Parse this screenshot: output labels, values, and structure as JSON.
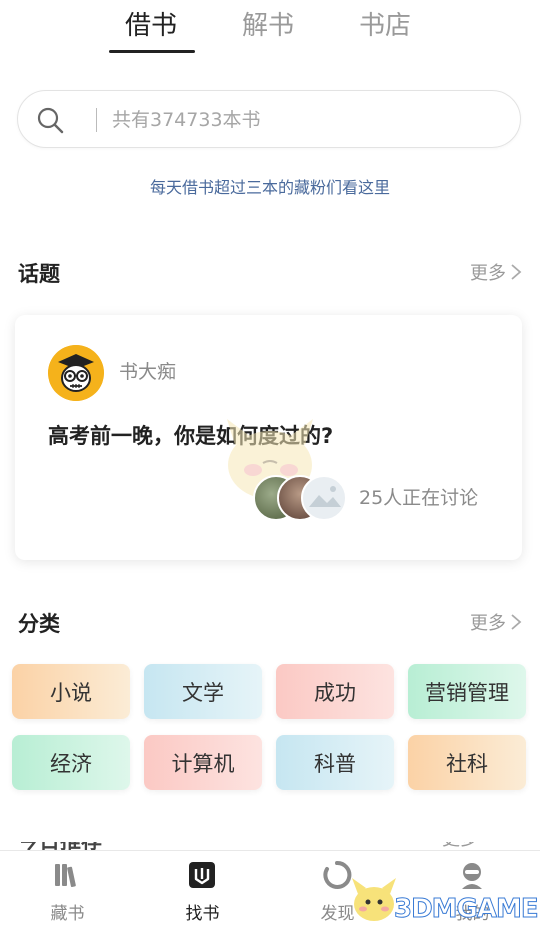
{
  "tabs": [
    {
      "label": "借书",
      "active": true
    },
    {
      "label": "解书",
      "active": false
    },
    {
      "label": "书店",
      "active": false
    }
  ],
  "search": {
    "placeholder": "共有374733本书",
    "icon": "search-icon"
  },
  "promo_link": "每天借书超过三本的藏粉们看这里",
  "topics": {
    "title": "话题",
    "more": "更多",
    "card": {
      "author": "书大痴",
      "question": "高考前一晚，你是如何度过的?",
      "discussing": "25人正在讨论"
    }
  },
  "categories": {
    "title": "分类",
    "more": "更多",
    "items": [
      {
        "label": "小说",
        "color": "#fbd9b0"
      },
      {
        "label": "文学",
        "color": "#cfeaf3"
      },
      {
        "label": "成功",
        "color": "#fbd0cc"
      },
      {
        "label": "营销管理",
        "color": "#c3f0da"
      },
      {
        "label": "经济",
        "color": "#c3f0da"
      },
      {
        "label": "计算机",
        "color": "#fbd0cc"
      },
      {
        "label": "科普",
        "color": "#cfeaf3"
      },
      {
        "label": "社科",
        "color": "#fbd9b0"
      }
    ]
  },
  "recommend": {
    "title": "今日推荐",
    "more": "更多"
  },
  "bottom_nav": [
    {
      "label": "藏书",
      "icon": "books-icon",
      "active": false
    },
    {
      "label": "找书",
      "icon": "find-book-icon",
      "active": true
    },
    {
      "label": "发现",
      "icon": "discover-icon",
      "active": false
    },
    {
      "label": "我的",
      "icon": "profile-icon",
      "active": false
    }
  ],
  "watermark": "3DMGAME",
  "colors": {
    "accent": "#222222",
    "link": "#4a6a9c",
    "muted": "#9a9a9a"
  }
}
